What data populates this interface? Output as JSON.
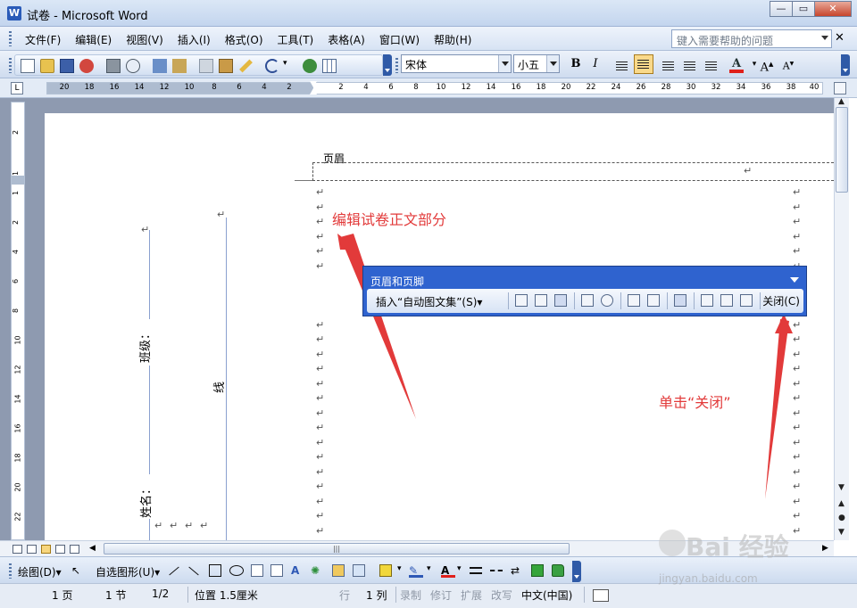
{
  "window": {
    "title": "试卷 - Microsoft Word",
    "app_icon": "W"
  },
  "menu": {
    "items": [
      "文件(F)",
      "编辑(E)",
      "视图(V)",
      "插入(I)",
      "格式(O)",
      "工具(T)",
      "表格(A)",
      "窗口(W)",
      "帮助(H)"
    ],
    "help_placeholder": "键入需要帮助的问题"
  },
  "format": {
    "font": "宋体",
    "size": "小五",
    "bold": "B",
    "italic": "I",
    "grow": "A",
    "shrink": "A"
  },
  "ruler": {
    "h_ticks": [
      "20",
      "18",
      "16",
      "14",
      "12",
      "10",
      "8",
      "6",
      "4",
      "2",
      "2",
      "4",
      "6",
      "8",
      "10",
      "12",
      "14",
      "16",
      "18",
      "20",
      "22",
      "24",
      "26",
      "28",
      "30",
      "32",
      "34",
      "36",
      "38",
      "40"
    ],
    "v_ticks": [
      "2",
      "1",
      "1",
      "2",
      "4",
      "6",
      "8",
      "10",
      "12",
      "14",
      "16",
      "18",
      "20",
      "22",
      "24",
      "26"
    ],
    "corner": "L"
  },
  "document": {
    "header_label": "页眉",
    "para_mark": "↵",
    "class_label": "班级：",
    "name_label": "姓名：",
    "line_label": "线"
  },
  "annotations": {
    "body_edit": "编辑试卷正文部分",
    "click_close": "单击“关闭”"
  },
  "hf_toolbar": {
    "title": "页眉和页脚",
    "insert_autotext": "插入“自动图文集”(S)▾",
    "close": "关闭(C)"
  },
  "drawing": {
    "draw": "绘图(D)▾",
    "autoshapes": "自选图形(U)▾"
  },
  "status": {
    "page": "1 页",
    "section": "1 节",
    "pages": "1/2",
    "position": "位置  1.5厘米",
    "row": "行",
    "col": "1 列",
    "rec": "录制",
    "trk": "修订",
    "ext": "扩展",
    "ovr": "改写",
    "lang": "中文(中国)"
  },
  "watermark": {
    "brand": "Bai  经验",
    "url": "jingyan.baidu.com"
  },
  "colors": {
    "accent": "#2f63cf",
    "annotation": "#e23a3a"
  },
  "icons": [
    "new-icon",
    "open-icon",
    "save-icon",
    "permission-icon",
    "print-icon",
    "print-preview-icon",
    "spelling-icon",
    "research-icon",
    "copy-icon",
    "paste-icon",
    "format-painter-icon",
    "undo-icon",
    "hyperlink-icon",
    "table-icon"
  ]
}
